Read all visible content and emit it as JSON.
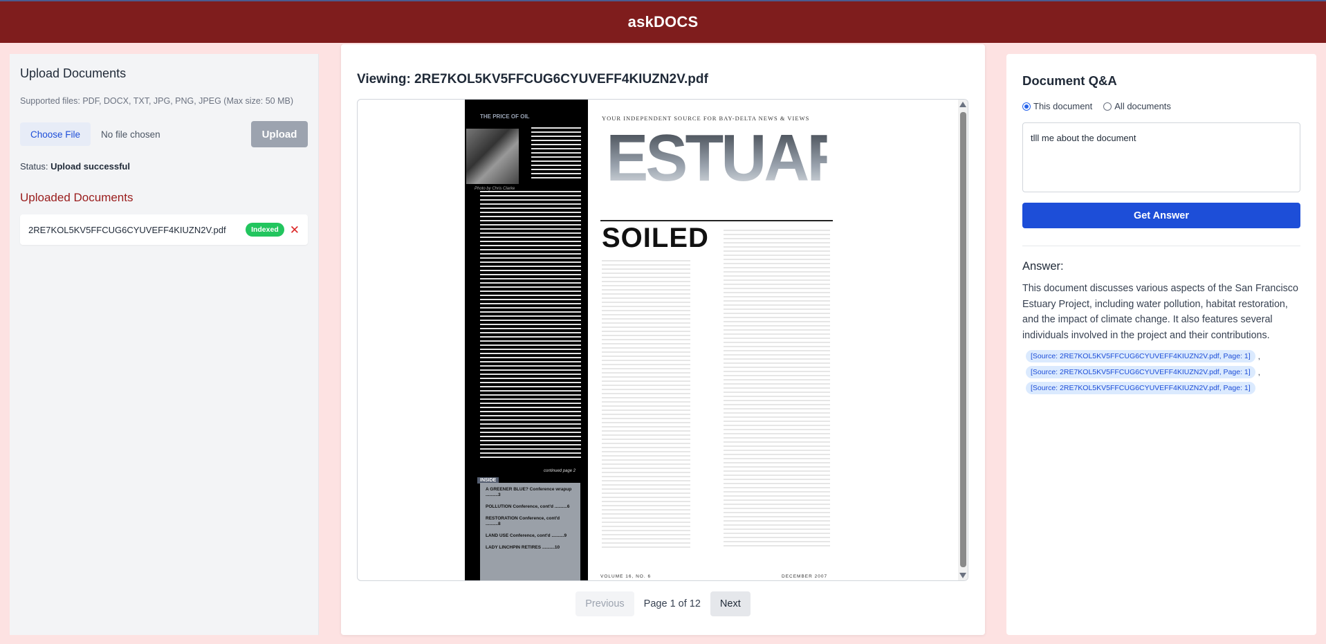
{
  "app": {
    "title": "askDOCS"
  },
  "left": {
    "heading": "Upload Documents",
    "supported": "Supported files: PDF, DOCX, TXT, JPG, PNG, JPEG (Max size: 50 MB)",
    "choose_label": "Choose File",
    "no_file": "No file chosen",
    "upload_label": "Upload",
    "status_label": "Status:",
    "status_value": "Upload successful",
    "uploaded_heading": "Uploaded Documents",
    "documents": [
      {
        "name": "2RE7KOL5KV5FFCUG6CYUVEFF4KIUZN2V.pdf",
        "badge": "Indexed",
        "remove": "✕"
      }
    ]
  },
  "viewer": {
    "heading": "Viewing: 2RE7KOL5KV5FFCUG6CYUVEFF4KIUZN2V.pdf",
    "pdf": {
      "kicker": "THE PRICE OF OIL",
      "photo_credit": "Photo by Chris Clarke",
      "tagline": "YOUR INDEPENDENT SOURCE FOR BAY-DELTA NEWS & VIEWS",
      "masthead": "ESTUARY",
      "headline": "SOILED",
      "continued": "continued page 2",
      "inside_tag": "INSIDE",
      "inside_items": [
        "A GREENER BLUE? Conference wrapup ..........3",
        "POLLUTION Conference, cont'd ..........6",
        "RESTORATION Conference, cont'd ..........8",
        "LAND USE Conference, cont'd ..........9",
        "LADY LINCHPIN RETIRES ..........10"
      ],
      "footer_left": "VOLUME 16, NO. 6",
      "footer_right": "DECEMBER 2007"
    },
    "prev_label": "Previous",
    "page_label": "Page 1 of 12",
    "next_label": "Next"
  },
  "qa": {
    "heading": "Document Q&A",
    "scope_options": [
      "This document",
      "All documents"
    ],
    "scope_selected": "This document",
    "query": "tlll me about the document",
    "ask_label": "Get Answer",
    "answer_label": "Answer:",
    "answer": "This document discusses various aspects of the San Francisco Estuary Project, including water pollution, habitat restoration, and the impact of climate change. It also features several individuals involved in the project and their contributions.",
    "sources": [
      "[Source: 2RE7KOL5KV5FFCUG6CYUVEFF4KIUZN2V.pdf, Page: 1]",
      "[Source: 2RE7KOL5KV5FFCUG6CYUVEFF4KIUZN2V.pdf, Page: 1]",
      "[Source: 2RE7KOL5KV5FFCUG6CYUVEFF4KIUZN2V.pdf, Page: 1]"
    ]
  },
  "colors": {
    "header": "#7f1d1d",
    "page_bg": "#fde2e2",
    "primary": "#1d4ed8",
    "indexed": "#22c55e",
    "danger": "#dc2626"
  }
}
